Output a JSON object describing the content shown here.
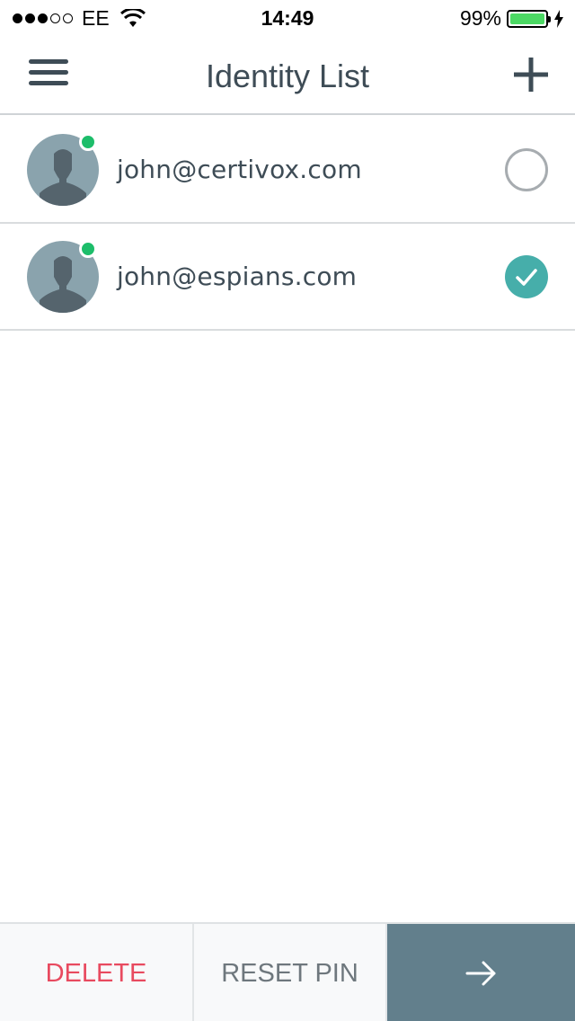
{
  "status_bar": {
    "carrier": "EE",
    "time": "14:49",
    "battery": "99%",
    "battery_level_percent": 99,
    "signal_bars_filled": 3,
    "signal_bars_total": 5
  },
  "header": {
    "title": "Identity List"
  },
  "identities": [
    {
      "email": "john@certivox.com",
      "online": true,
      "selected": false
    },
    {
      "email": "john@espians.com",
      "online": true,
      "selected": true
    }
  ],
  "bottom_bar": {
    "delete_label": "DELETE",
    "reset_pin_label": "RESET PIN",
    "next_icon": "arrow-right-icon"
  },
  "colors": {
    "online": "#1dbd6a",
    "selected": "#46aeaa",
    "delete": "#e84a5f",
    "next_button": "#627f8c",
    "battery": "#4cd964"
  }
}
